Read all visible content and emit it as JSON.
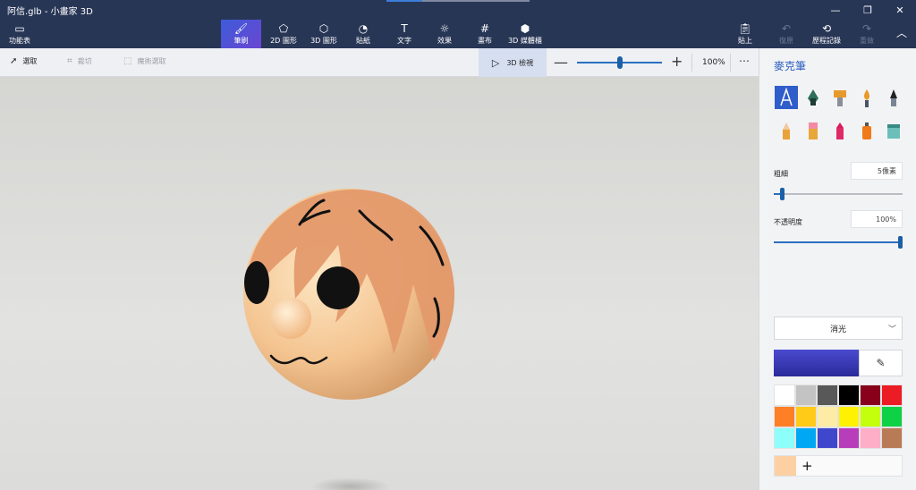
{
  "window": {
    "title": "阿信.glb - 小畫家 3D"
  },
  "ribbon": {
    "menu_label": "功能表",
    "tabs": [
      {
        "label": "筆刷",
        "icon": "brush-icon",
        "active": true
      },
      {
        "label": "2D 圖形",
        "icon": "2d-shapes-icon"
      },
      {
        "label": "3D 圖形",
        "icon": "3d-shapes-icon"
      },
      {
        "label": "貼紙",
        "icon": "stickers-icon"
      },
      {
        "label": "文字",
        "icon": "text-icon"
      },
      {
        "label": "效果",
        "icon": "effects-icon"
      },
      {
        "label": "畫布",
        "icon": "canvas-icon"
      },
      {
        "label": "3D 媒體櫃",
        "icon": "3d-library-icon"
      }
    ],
    "paste_label": "貼上",
    "undo_label": "復原",
    "history_label": "歷程記錄",
    "redo_label": "重做"
  },
  "toolbar": {
    "select_label": "選取",
    "crop_label": "裁切",
    "magic_select_label": "魔術選取",
    "view3d_label": "3D 檢視",
    "zoom_value": "100%",
    "zoom_level": 0.5
  },
  "panel": {
    "title": "麥克筆",
    "thickness_label": "粗細",
    "thickness_value": "5像素",
    "thickness_level": 0.05,
    "opacity_label": "不透明度",
    "opacity_value": "100%",
    "opacity_level": 1.0,
    "finish_value": "消光",
    "current_color": "#4a4ad0",
    "custom_color": "#fdd0a3",
    "add_color_label": "+",
    "palette": [
      "#ffffff",
      "#c3c3c3",
      "#585858",
      "#000000",
      "#88001b",
      "#ec1c24",
      "#ff7f27",
      "#ffca18",
      "#fdeca6",
      "#fff200",
      "#c4ff0e",
      "#0ed145",
      "#8cfffb",
      "#00a8f3",
      "#3f48cc",
      "#b83dba",
      "#ffaec8",
      "#b97a56"
    ]
  }
}
